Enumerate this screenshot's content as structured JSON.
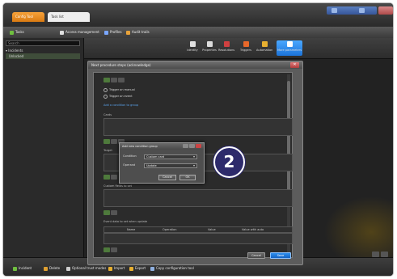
{
  "titlebar": {
    "tabs": [
      {
        "label": "Config Tool"
      },
      {
        "label": "Task list"
      }
    ]
  },
  "toolbar": {
    "items": [
      {
        "label": "Tasks",
        "icon": "tasks-icon",
        "color": "#6fbf3f"
      },
      {
        "label": "Access management",
        "icon": "access-icon",
        "color": "#e0e0e0"
      },
      {
        "label": "Profiles",
        "icon": "profiles-icon",
        "color": "#7aa7ff"
      },
      {
        "label": "Audit trails",
        "icon": "audit-icon",
        "color": "#e8a23a"
      }
    ]
  },
  "sidebar": {
    "search_placeholder": "Search",
    "tree": [
      {
        "label": "Incidents"
      },
      {
        "label": "Unlocked"
      }
    ]
  },
  "ribbon": {
    "items": [
      {
        "label": "Identity",
        "icon": "identity-icon",
        "color": "#e0e0e0"
      },
      {
        "label": "Properties",
        "icon": "properties-icon",
        "color": "#dcdcdc"
      },
      {
        "label": "Resolutions",
        "icon": "resolutions-icon",
        "color": "#d04040"
      },
      {
        "label": "Triggers",
        "icon": "triggers-icon",
        "color": "#e8682a"
      },
      {
        "label": "Automation",
        "icon": "automation-icon",
        "color": "#e8b030"
      },
      {
        "label": "More parameters",
        "icon": "more-params-icon",
        "color": "#ffffff"
      }
    ]
  },
  "bottombar": {
    "items": [
      {
        "label": "Incident",
        "icon": "add-icon",
        "color": "#6fbf3f"
      },
      {
        "label": "Delete",
        "icon": "delete-icon",
        "color": "#e0a030"
      },
      {
        "label": "Optional trust modes",
        "icon": "trust-icon",
        "color": "#cfcfcf"
      },
      {
        "label": "Import",
        "icon": "import-icon",
        "color": "#e8b030"
      },
      {
        "label": "Export",
        "icon": "export-icon",
        "color": "#e8b030"
      },
      {
        "label": "Copy configuration tool",
        "icon": "copy-icon",
        "color": "#8fb0e0"
      }
    ]
  },
  "dialog": {
    "title": "Next procedure steps (acknowledge)",
    "options": [
      {
        "label": "Trigger on manual"
      },
      {
        "label": "Trigger on event"
      }
    ],
    "link": "Add a condition to group",
    "labels": [
      "Cards",
      "Target",
      "Custom fields to set",
      "Event data to set when update"
    ],
    "grid_headers": [
      "Name",
      "Operation",
      "Value",
      "Value with auto"
    ],
    "ok": "Cancel",
    "primary": "Save"
  },
  "condition": {
    "title": "Add new condition group",
    "rows": [
      {
        "label": "Condition",
        "value": "Custom card"
      },
      {
        "label": "Operand",
        "value": "Update"
      }
    ],
    "ok": "Cancel",
    "cancel": "OK"
  },
  "callout": {
    "number": "2"
  }
}
